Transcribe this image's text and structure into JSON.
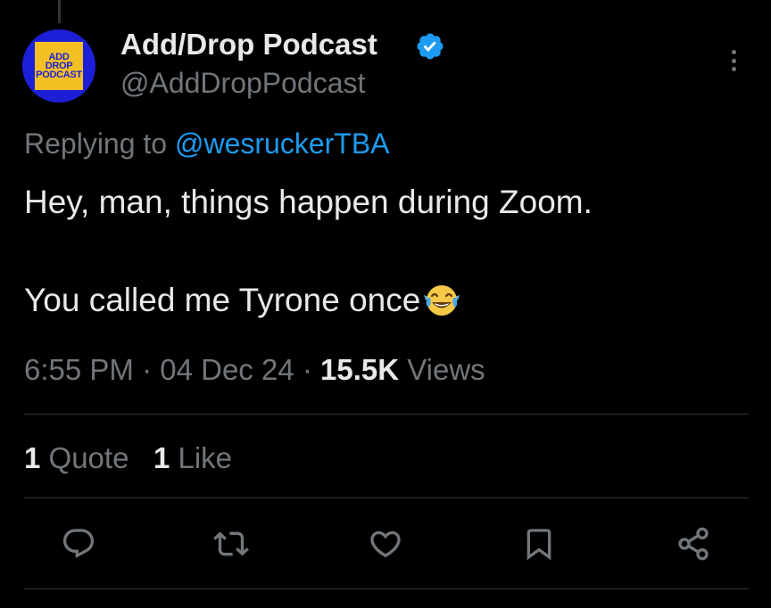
{
  "author": {
    "display_name": "Add/Drop Podcast",
    "handle": "@AddDropPodcast",
    "verified": true,
    "avatar_text": [
      "ADD",
      "DROP",
      "PODCAST"
    ],
    "avatar_colors": {
      "ring": "#1d1fd6",
      "tile": "#f3c024"
    }
  },
  "reply": {
    "prefix": "Replying to",
    "mention": "@wesruckerTBA"
  },
  "tweet": {
    "line1": "Hey, man, things happen during Zoom.",
    "line2": "You called me Tyrone once",
    "emoji": "face-with-tears-of-joy"
  },
  "meta": {
    "time": "6:55 PM",
    "sep1": " · ",
    "date": "04 Dec 24",
    "sep2": " · ",
    "views_count": "15.5K",
    "views_label": " Views"
  },
  "stats": {
    "quotes_count": "1",
    "quotes_label": " Quote",
    "likes_count": "1",
    "likes_label": " Like"
  },
  "actions": [
    "reply-icon",
    "retweet-icon",
    "like-icon",
    "bookmark-icon",
    "share-icon"
  ],
  "colors": {
    "background": "#000000",
    "text": "#e7e9ea",
    "secondary": "#71767b",
    "accent": "#1d9bf0",
    "divider": "#2f3336"
  }
}
